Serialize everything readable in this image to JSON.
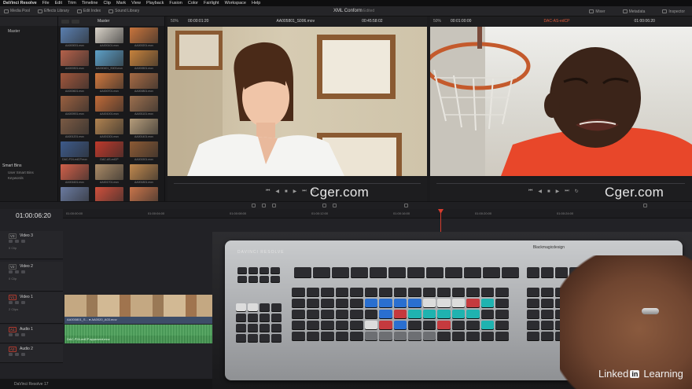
{
  "menu": [
    "DaVinci Resolve",
    "File",
    "Edit",
    "Trim",
    "Timeline",
    "Clip",
    "Mark",
    "View",
    "Playback",
    "Fusion",
    "Color",
    "Fairlight",
    "Workspace",
    "Help"
  ],
  "toolbar": {
    "media_pool": "Media Pool",
    "effects_library": "Effects Library",
    "edit_index": "Edit Index",
    "sound_library": "Sound Library",
    "title": "XML Conform",
    "subtitle": "Edited",
    "mixer": "Mixer",
    "metadata": "Metadata",
    "inspector": "Inspector"
  },
  "left_panel": {
    "header": "Master",
    "bin": "Master",
    "smart_bins_title": "Smart Bins",
    "smart_items": [
      "User Smart Bins",
      "Keywords"
    ]
  },
  "source_viewer": {
    "zoom": "50%",
    "timecode_in": "00:00:01:20",
    "clip_name": "AA005801_S006.mov",
    "duration": "00:45:58:02",
    "watermark": "Cger.com"
  },
  "record_viewer": {
    "zoom": "50%",
    "timecode": "00:01:00:00",
    "clip_name": "DAC-AS-edCP",
    "timecode_out": "01:00:06:20",
    "watermark": "Cger.com"
  },
  "media_pool": {
    "clips": [
      {
        "name": "AA000001.mov",
        "color": "#5a7fb0"
      },
      {
        "name": "AA000101.mov",
        "color": "#d9d3c9"
      },
      {
        "name": "AA000201.mov",
        "color": "#c9743c"
      },
      {
        "name": "AA000301.mov",
        "color": "#b5614a"
      },
      {
        "name": "AA000401_S003.mov",
        "color": "#5da0c8"
      },
      {
        "name": "AA000501.mov",
        "color": "#c7823c"
      },
      {
        "name": "AA000601.mov",
        "color": "#a0563c"
      },
      {
        "name": "AA000701.mov",
        "color": "#d0783e"
      },
      {
        "name": "AA000801.mov",
        "color": "#a66a44"
      },
      {
        "name": "AA000901.mov",
        "color": "#9a6040"
      },
      {
        "name": "AA001001.mov",
        "color": "#c06a38"
      },
      {
        "name": "AA001101.mov",
        "color": "#9c6f4e"
      },
      {
        "name": "AA001201.mov",
        "color": "#7a5a44"
      },
      {
        "name": "AA001301.mov",
        "color": "#b08250"
      },
      {
        "name": "AA001401.mov",
        "color": "#b59c7a"
      },
      {
        "name": "DAC-P24-edCP.mov",
        "color": "#3d5a8a"
      },
      {
        "name": "DAC-AS-edCP",
        "color": "#c0392b"
      },
      {
        "name": "AA001501.mov",
        "color": "#8c5a34"
      },
      {
        "name": "AA001601.mov",
        "color": "#d0604a"
      },
      {
        "name": "AA001701.mov",
        "color": "#aa8a66"
      },
      {
        "name": "AA001801.mov",
        "color": "#c0884e"
      },
      {
        "name": "AA001901_S008.mov",
        "color": "#6a7aa0"
      },
      {
        "name": "AA002001_A03.mov",
        "color": "#d0503c"
      },
      {
        "name": "AA002101.mov",
        "color": "#c8744a"
      }
    ]
  },
  "timeline": {
    "timecode": "01:00:06:20",
    "ruler": [
      "01:00:00:00",
      "01:00:04:00",
      "01:00:08:00",
      "01:00:12:00",
      "01:00:16:00",
      "01:00:20:00",
      "01:00:24:00"
    ],
    "tracks": [
      {
        "tag": "V3",
        "name": "Video 3",
        "sub": "0 Clip"
      },
      {
        "tag": "V2",
        "name": "Video 2",
        "sub": "0 Clip"
      },
      {
        "tag": "V1",
        "name": "Video 1",
        "sub": "2 Clips"
      },
      {
        "tag": "A1",
        "name": "Audio 1",
        "sub": ""
      },
      {
        "tag": "A2",
        "name": "Audio 2",
        "sub": ""
      }
    ],
    "video_clip": "AA000801_S... ● AA0020_A03.mov",
    "audio_clip_1": "",
    "audio_clip_2": "DAC-P24-edCP approved.mov"
  },
  "console": {
    "brand": "DAVINCI RESOLVE",
    "maker": "Blackmagicdesign"
  },
  "brand": {
    "linkedin": "Linked",
    "in": "in",
    "learning": "Learning"
  },
  "status": {
    "label": "DaVinci Resolve 17"
  }
}
